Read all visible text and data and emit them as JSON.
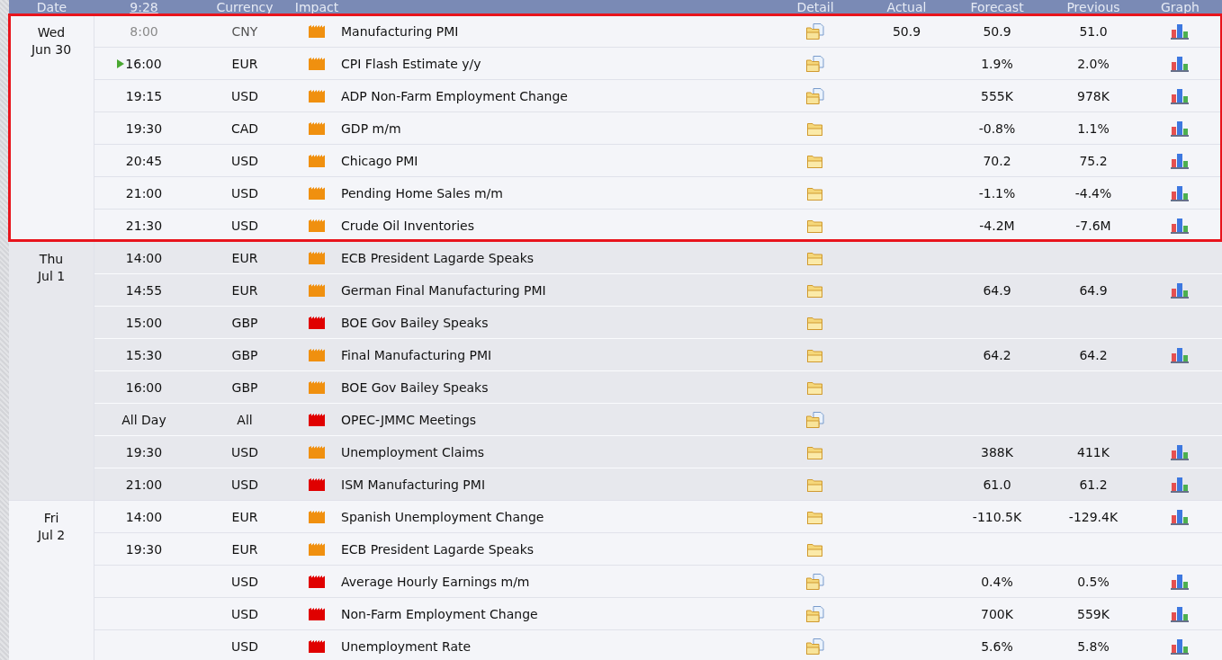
{
  "header": {
    "columns": [
      {
        "label": "Date",
        "link": false
      },
      {
        "label": "9:28",
        "link": true
      },
      {
        "label": "Currency",
        "link": false
      },
      {
        "label": "Impact",
        "link": false
      },
      {
        "label": "Detail",
        "link": false
      },
      {
        "label": "Actual",
        "link": false
      },
      {
        "label": "Forecast",
        "link": false
      },
      {
        "label": "Previous",
        "link": false
      },
      {
        "label": "Graph",
        "link": false
      }
    ]
  },
  "days": [
    {
      "weekday": "Wed",
      "date": "Jun 30",
      "highlighted": true,
      "events": [
        {
          "time": "8:00",
          "past": true,
          "next": false,
          "currency": "CNY",
          "color": "#f0900f",
          "event": "Manufacturing PMI",
          "has_document": true,
          "actual": "50.9",
          "forecast": "50.9",
          "previous": "51.0",
          "graph": true
        },
        {
          "time": "16:00",
          "past": false,
          "next": true,
          "currency": "EUR",
          "color": "#f0900f",
          "event": "CPI Flash Estimate y/y",
          "has_document": true,
          "forecast": "1.9%",
          "previous": "2.0%",
          "graph": true
        },
        {
          "time": "19:15",
          "past": false,
          "next": false,
          "currency": "USD",
          "color": "#f0900f",
          "event": "ADP Non-Farm Employment Change",
          "has_document": true,
          "forecast": "555K",
          "previous": "978K",
          "graph": true
        },
        {
          "time": "19:30",
          "past": false,
          "next": false,
          "currency": "CAD",
          "color": "#f0900f",
          "event": "GDP m/m",
          "has_document": false,
          "forecast": "-0.8%",
          "previous": "1.1%",
          "graph": true
        },
        {
          "time": "20:45",
          "past": false,
          "next": false,
          "currency": "USD",
          "color": "#f0900f",
          "event": "Chicago PMI",
          "has_document": false,
          "forecast": "70.2",
          "previous": "75.2",
          "graph": true
        },
        {
          "time": "21:00",
          "past": false,
          "next": false,
          "currency": "USD",
          "color": "#f0900f",
          "event": "Pending Home Sales m/m",
          "has_document": false,
          "forecast": "-1.1%",
          "previous": "-4.4%",
          "graph": true
        },
        {
          "time": "21:30",
          "past": false,
          "next": false,
          "currency": "USD",
          "color": "#f0900f",
          "event": "Crude Oil Inventories",
          "has_document": false,
          "forecast": "-4.2M",
          "previous": "-7.6M",
          "graph": true
        }
      ]
    },
    {
      "weekday": "Thu",
      "date": "Jul 1",
      "highlighted": false,
      "events": [
        {
          "time": "14:00",
          "past": false,
          "next": false,
          "currency": "EUR",
          "color": "#f0900f",
          "event": "ECB President Lagarde Speaks",
          "has_document": false,
          "graph": false
        },
        {
          "time": "14:55",
          "past": false,
          "next": false,
          "currency": "EUR",
          "color": "#f0900f",
          "event": "German Final Manufacturing PMI",
          "has_document": false,
          "forecast": "64.9",
          "previous": "64.9",
          "graph": true
        },
        {
          "time": "15:00",
          "past": false,
          "next": false,
          "currency": "GBP",
          "color": "#e00000",
          "event": "BOE Gov Bailey Speaks",
          "has_document": false,
          "graph": false
        },
        {
          "time": "15:30",
          "past": false,
          "next": false,
          "currency": "GBP",
          "color": "#f0900f",
          "event": "Final Manufacturing PMI",
          "has_document": false,
          "forecast": "64.2",
          "previous": "64.2",
          "graph": true
        },
        {
          "time": "16:00",
          "past": false,
          "next": false,
          "currency": "GBP",
          "color": "#f0900f",
          "event": "BOE Gov Bailey Speaks",
          "has_document": false,
          "graph": false
        },
        {
          "time": "All Day",
          "past": false,
          "next": false,
          "currency": "All",
          "color": "#e00000",
          "event": "OPEC-JMMC Meetings",
          "has_document": true,
          "graph": false
        },
        {
          "time": "19:30",
          "past": false,
          "next": false,
          "currency": "USD",
          "color": "#f0900f",
          "event": "Unemployment Claims",
          "has_document": false,
          "forecast": "388K",
          "previous": "411K",
          "graph": true
        },
        {
          "time": "21:00",
          "past": false,
          "next": false,
          "currency": "USD",
          "color": "#e00000",
          "event": "ISM Manufacturing PMI",
          "has_document": false,
          "forecast": "61.0",
          "previous": "61.2",
          "graph": true
        }
      ]
    },
    {
      "weekday": "Fri",
      "date": "Jul 2",
      "highlighted": false,
      "events": [
        {
          "time": "14:00",
          "past": false,
          "next": false,
          "currency": "EUR",
          "color": "#f0900f",
          "event": "Spanish Unemployment Change",
          "has_document": false,
          "forecast": "-110.5K",
          "previous": "-129.4K",
          "graph": true
        },
        {
          "time": "19:30",
          "past": false,
          "next": false,
          "currency": "EUR",
          "color": "#f0900f",
          "event": "ECB President Lagarde Speaks",
          "has_document": false,
          "graph": false
        },
        {
          "currency": "USD",
          "color": "#e00000",
          "event": "Average Hourly Earnings m/m",
          "has_document": true,
          "forecast": "0.4%",
          "previous": "0.5%",
          "graph": true
        },
        {
          "currency": "USD",
          "color": "#e00000",
          "event": "Non-Farm Employment Change",
          "has_document": true,
          "forecast": "700K",
          "previous": "559K",
          "graph": true
        },
        {
          "currency": "USD",
          "color": "#e00000",
          "event": "Unemployment Rate",
          "has_document": true,
          "forecast": "5.6%",
          "previous": "5.8%",
          "graph": true
        }
      ]
    }
  ]
}
